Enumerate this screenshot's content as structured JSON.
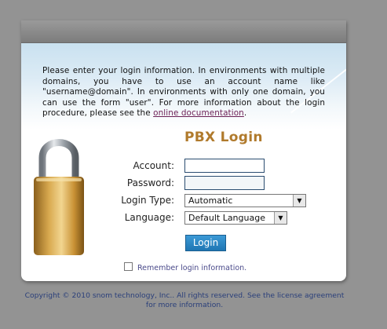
{
  "intro": {
    "text_before_link": "Please enter your login information. In environments with multiple domains, you have to use an account name like \"username@domain\". In environments with only one domain, you can use the form \"user\". For more information about the login procedure, please see the ",
    "link_text": "online documentation",
    "text_after_link": "."
  },
  "form": {
    "title": "PBX Login",
    "account_label": "Account:",
    "account_value": "",
    "password_label": "Password:",
    "password_value": "",
    "login_type_label": "Login Type:",
    "login_type_value": "Automatic",
    "language_label": "Language:",
    "language_value": "Default Language",
    "login_button": "Login",
    "remember_label": "Remember login information.",
    "remember_checked": false
  },
  "footer": {
    "copyright": "Copyright © 2010 snom technology, Inc.. All rights reserved. See the license agreement for more information."
  },
  "colors": {
    "title": "#b07a2c",
    "button": "#1f76b3",
    "background": "#939393"
  },
  "icons": {
    "lock": "padlock-icon",
    "dropdown": "chevron-down-icon"
  }
}
